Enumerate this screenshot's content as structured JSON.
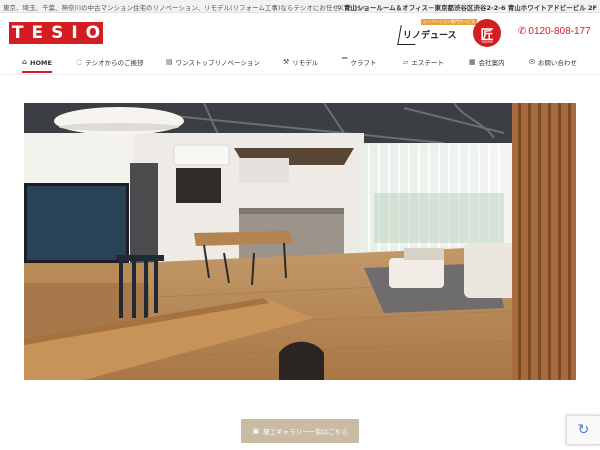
{
  "topbar": {
    "tagline": "東京、埼玉、千葉、神奈川の中古マンション住宅のリノベーション、リモデル(リフォーム工事)ならテシオにお任せください。",
    "address": "青山ショールーム＆オフィス－東京都渋谷区渋谷2-2-6 青山ホワイトアドビービル 2F"
  },
  "header": {
    "logo_text": "TESIO",
    "brand2_badge": "リノベーション専門サービス",
    "brand2_text": "リノデュース",
    "brand3_text": "匠",
    "brand3_sub": "TAKUMI",
    "phone": "0120-808-177"
  },
  "nav": {
    "items": [
      {
        "label": "HOME",
        "icon": "home-icon"
      },
      {
        "label": "テシオからのご挨拶",
        "icon": "chat-icon"
      },
      {
        "label": "ワンストップリノベーション",
        "icon": "building-icon"
      },
      {
        "label": "リモデル",
        "icon": "hammer-icon"
      },
      {
        "label": "クラフト",
        "icon": "paint-roller-icon"
      },
      {
        "label": "エステート",
        "icon": "map-icon"
      },
      {
        "label": "会社案内",
        "icon": "building-icon"
      },
      {
        "label": "お問い合わせ",
        "icon": "mail-icon"
      }
    ]
  },
  "hero": {
    "description": "renovated apartment interior with wooden floor, kitchen counter, dining table and living area"
  },
  "gallery_button": {
    "label": "施工ギャラリー一覧はこちら",
    "icon": "gallery-icon"
  },
  "colors": {
    "brand_red": "#d21d22",
    "button_beige": "#c9bba4"
  }
}
